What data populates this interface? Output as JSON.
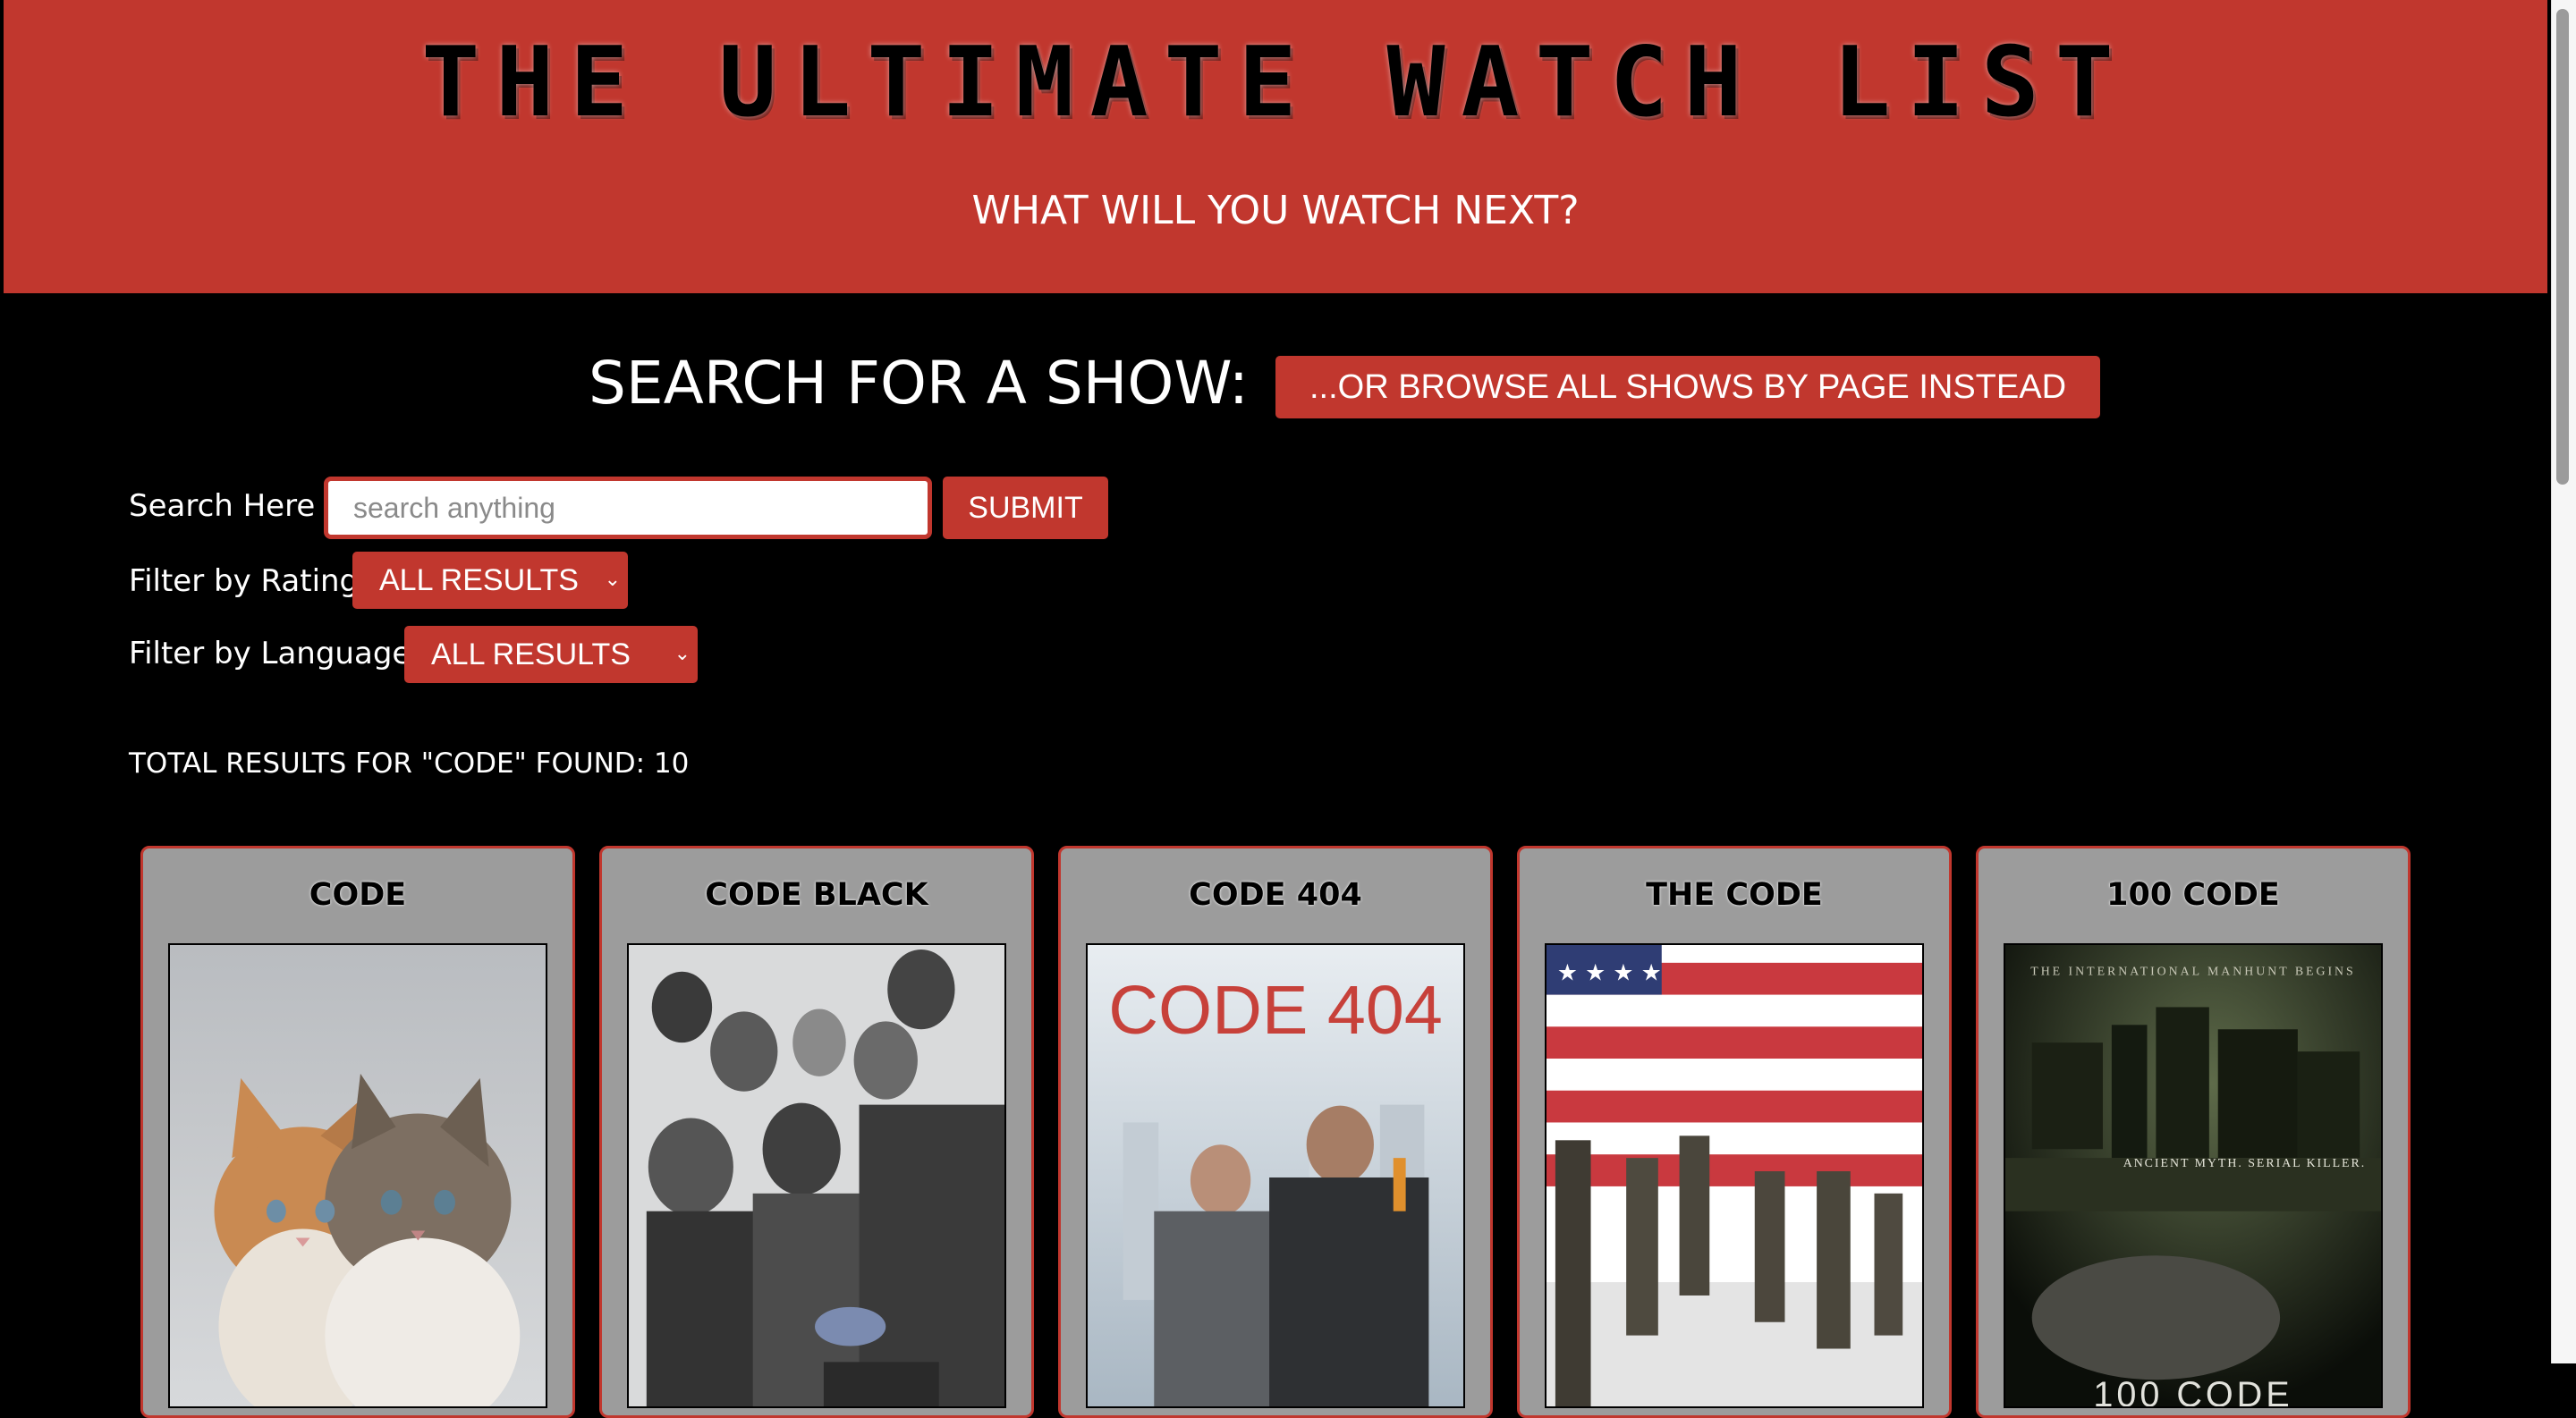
{
  "header": {
    "title": "THE ULTIMATE WATCH LIST",
    "subtitle": "WHAT WILL YOU WATCH NEXT?"
  },
  "search_section": {
    "heading": "SEARCH FOR A SHOW:",
    "browse_button_label": "...OR BROWSE ALL SHOWS BY PAGE INSTEAD",
    "search_label": "Search Here :",
    "search_placeholder": "search anything",
    "search_value": "",
    "submit_label": "SUBMIT",
    "rating_label": "Filter by Rating:",
    "rating_selected": "ALL RESULTS",
    "language_label": "Filter by Language:",
    "language_selected": "ALL RESULTS"
  },
  "results": {
    "summary": "TOTAL RESULTS FOR \"CODE\" FOUND: 10",
    "cards": [
      {
        "title": "CODE",
        "poster_icon": "kittens-poster"
      },
      {
        "title": "CODE BLACK",
        "poster_icon": "medical-cast-poster"
      },
      {
        "title": "CODE 404",
        "poster_icon": "code-404-poster",
        "poster_text": "CODE 404"
      },
      {
        "title": "THE CODE",
        "poster_icon": "american-flag-poster"
      },
      {
        "title": "100 CODE",
        "poster_icon": "dark-city-poster",
        "poster_tagline_top": "THE INTERNATIONAL MANHUNT BEGINS",
        "poster_tagline_mid": "ANCIENT MYTH. SERIAL KILLER.",
        "poster_logo": "100 CODE"
      }
    ]
  },
  "colors": {
    "accent": "#c1372e",
    "background": "#000000",
    "card": "#9c9c9c"
  }
}
